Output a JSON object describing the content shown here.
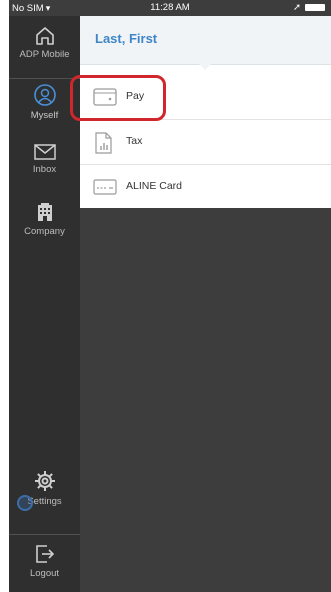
{
  "status_bar": {
    "carrier": "No SIM",
    "time": "11:28 AM"
  },
  "sidebar": {
    "items": [
      {
        "label": "ADP Mobile",
        "icon": "home-icon"
      },
      {
        "label": "Myself",
        "icon": "person-icon",
        "active": true
      },
      {
        "label": "Inbox",
        "icon": "envelope-icon"
      },
      {
        "label": "Company",
        "icon": "building-icon"
      },
      {
        "label": "Settings",
        "icon": "gear-icon"
      },
      {
        "label": "Logout",
        "icon": "logout-icon"
      }
    ]
  },
  "panel": {
    "title": "Last, First",
    "items": [
      {
        "label": "Pay",
        "icon": "wallet-icon",
        "highlighted": true
      },
      {
        "label": "Tax",
        "icon": "tax-document-icon"
      },
      {
        "label": "ALINE Card",
        "icon": "card-icon"
      }
    ]
  },
  "colors": {
    "accent": "#3f86c6",
    "highlight": "#d0262c",
    "sidebar": "#2f2f2f",
    "background": "#3d3d3d"
  }
}
